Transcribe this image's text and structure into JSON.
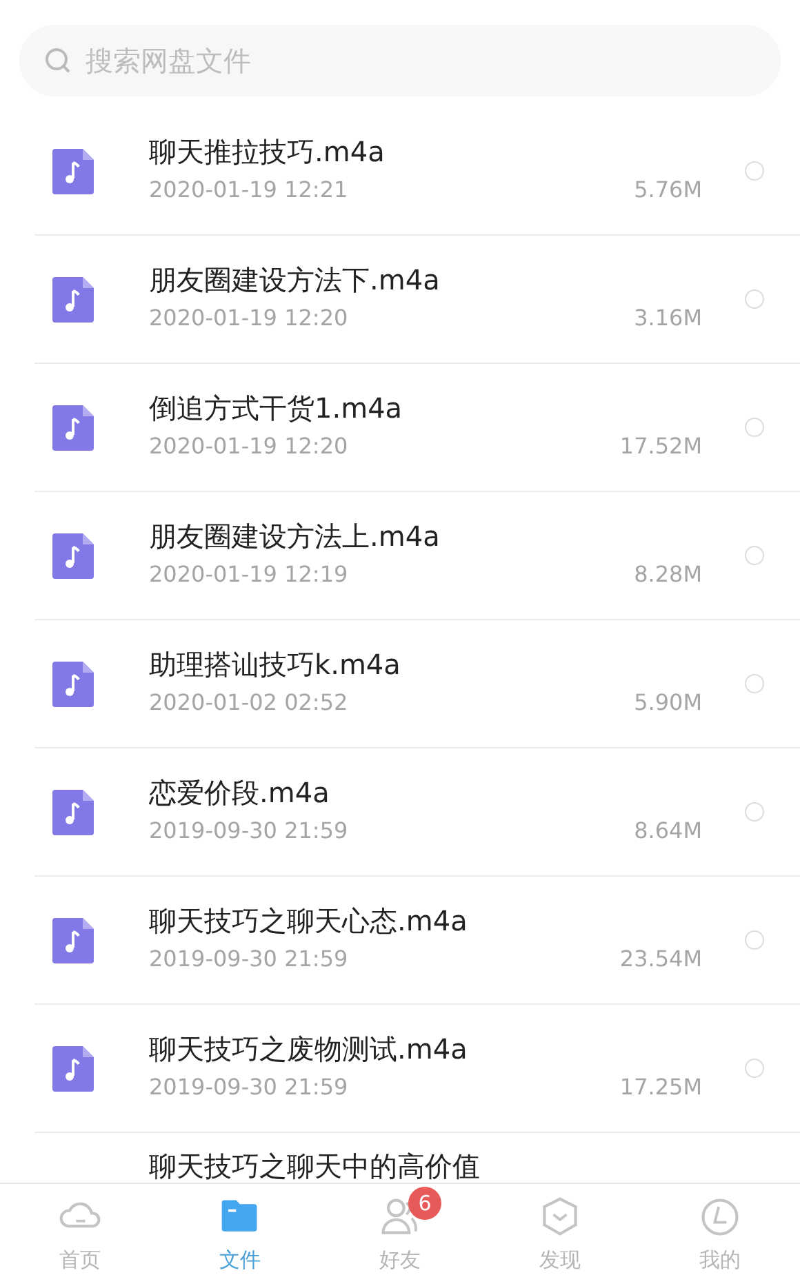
{
  "search": {
    "placeholder": "搜索网盘文件"
  },
  "files": [
    {
      "name": "聊天推拉技巧.m4a",
      "date": "2020-01-19 12:21",
      "size": "5.76M",
      "selected": false
    },
    {
      "name": "朋友圈建设方法下.m4a",
      "date": "2020-01-19 12:20",
      "size": "3.16M",
      "selected": false
    },
    {
      "name": "倒追方式干货1.m4a",
      "date": "2020-01-19 12:20",
      "size": "17.52M",
      "selected": false
    },
    {
      "name": "朋友圈建设方法上.m4a",
      "date": "2020-01-19 12:19",
      "size": "8.28M",
      "selected": false
    },
    {
      "name": "助理搭讪技巧k.m4a",
      "date": "2020-01-02 02:52",
      "size": "5.90M",
      "selected": false
    },
    {
      "name": "恋爱价段.m4a",
      "date": "2019-09-30 21:59",
      "size": "8.64M",
      "selected": false
    },
    {
      "name": "聊天技巧之聊天心态.m4a",
      "date": "2019-09-30 21:59",
      "size": "23.54M",
      "selected": false
    },
    {
      "name": "聊天技巧之废物测试.m4a",
      "date": "2019-09-30 21:59",
      "size": "17.25M",
      "selected": false
    },
    {
      "name": "聊天技巧之聊天中的高价值",
      "kind": "partial"
    }
  ],
  "tabbar": [
    {
      "label": "首页",
      "kind": "cloud",
      "selected": false
    },
    {
      "label": "文件",
      "kind": "folder",
      "selected": true
    },
    {
      "label": "好友",
      "kind": "friends",
      "selected": false,
      "badge": "6"
    },
    {
      "label": "发现",
      "kind": "discover",
      "selected": false
    },
    {
      "label": "我的",
      "kind": "me",
      "selected": false
    }
  ]
}
